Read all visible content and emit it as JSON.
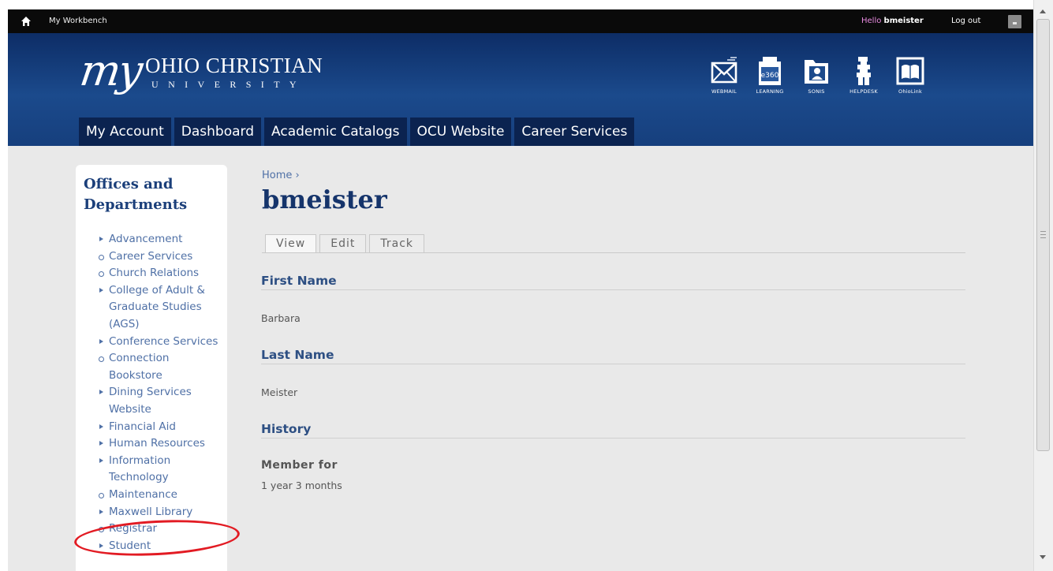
{
  "admin_bar": {
    "workbench_label": "My Workbench",
    "hello_prefix": "Hello ",
    "username": "bmeister",
    "logout_label": "Log out"
  },
  "header": {
    "logo_script": "my",
    "logo_name": "OHIO CHRISTIAN",
    "logo_sub": "UNIVERSITY",
    "quick_links": [
      {
        "label": "WEBMAIL",
        "icon": "envelope-icon"
      },
      {
        "label": "LEARNING",
        "icon": "e360-icon",
        "badge": "e360"
      },
      {
        "label": "SONIS",
        "icon": "folder-person-icon"
      },
      {
        "label": "HELPDESK",
        "icon": "helpdesk-icon"
      },
      {
        "label": "OhioLink",
        "icon": "book-icon"
      }
    ]
  },
  "nav": {
    "items": [
      "My Account",
      "Dashboard",
      "Academic Catalogs",
      "OCU Website",
      "Career Services"
    ]
  },
  "sidebar": {
    "heading": "Offices and Departments",
    "items": [
      {
        "label": "Advancement",
        "type": "collapsed"
      },
      {
        "label": "Career Services",
        "type": "leaf"
      },
      {
        "label": "Church Relations",
        "type": "leaf"
      },
      {
        "label": "College of Adult & Graduate Studies (AGS)",
        "type": "collapsed"
      },
      {
        "label": "Conference Services",
        "type": "collapsed"
      },
      {
        "label": "Connection Bookstore",
        "type": "leaf"
      },
      {
        "label": "Dining Services Website",
        "type": "collapsed"
      },
      {
        "label": "Financial Aid",
        "type": "collapsed"
      },
      {
        "label": "Human Resources",
        "type": "collapsed"
      },
      {
        "label": "Information Technology",
        "type": "collapsed"
      },
      {
        "label": "Maintenance",
        "type": "leaf"
      },
      {
        "label": "Maxwell Library",
        "type": "collapsed"
      },
      {
        "label": "Registrar",
        "type": "leaf"
      },
      {
        "label": "Student",
        "type": "collapsed"
      }
    ]
  },
  "content": {
    "breadcrumb": "Home ›",
    "title": "bmeister",
    "tabs": [
      "View",
      "Edit",
      "Track"
    ],
    "first_name_heading": "First Name",
    "first_name_value": "Barbara",
    "last_name_heading": "Last Name",
    "last_name_value": "Meister",
    "history_heading": "History",
    "member_for_label": "Member for",
    "member_for_value": "1 year 3 months"
  },
  "colors": {
    "header_blue": "#1b4a8c",
    "nav_dark": "#0b2350",
    "link_blue": "#4f70a6",
    "highlight_red": "#e21b23"
  }
}
